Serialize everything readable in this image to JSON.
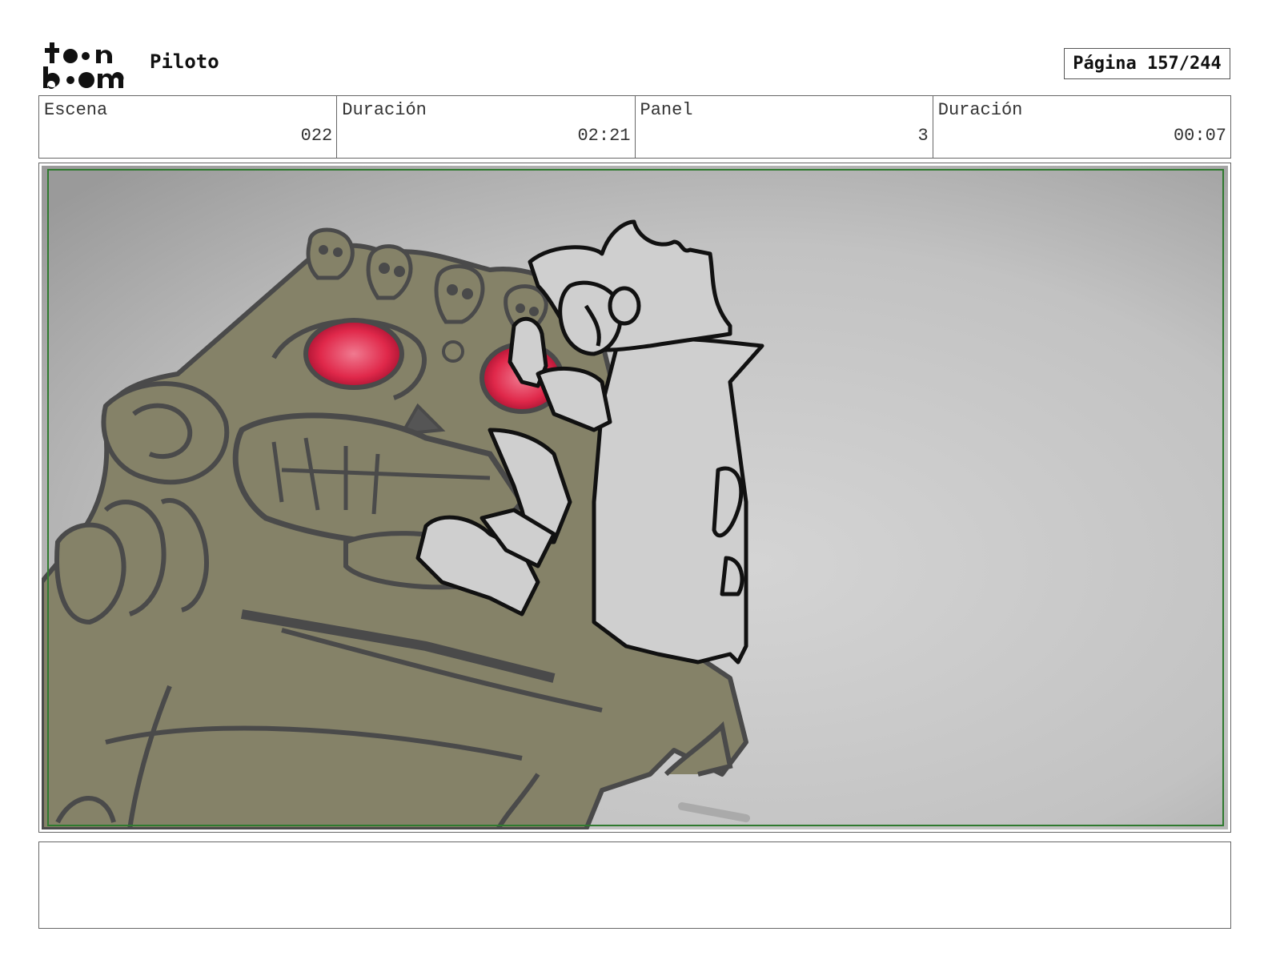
{
  "header": {
    "logo_alt": "toon boom",
    "project_title": "Piloto",
    "page_label": "Página 157/244"
  },
  "info": [
    {
      "label": "Escena",
      "value": "022"
    },
    {
      "label": "Duración",
      "value": "02:21"
    },
    {
      "label": "Panel",
      "value": "3"
    },
    {
      "label": "Duración",
      "value": "00:07"
    }
  ],
  "panel": {
    "frame_color": "#2f7a2f",
    "drawing_description_icon": "storyboard-drawing"
  },
  "notes": {
    "text": ""
  },
  "colors": {
    "monster_body": "#858268",
    "monster_eye": "#e0284a",
    "background_gray": "#bdbdbd",
    "character_fill": "#cfcfcf"
  }
}
